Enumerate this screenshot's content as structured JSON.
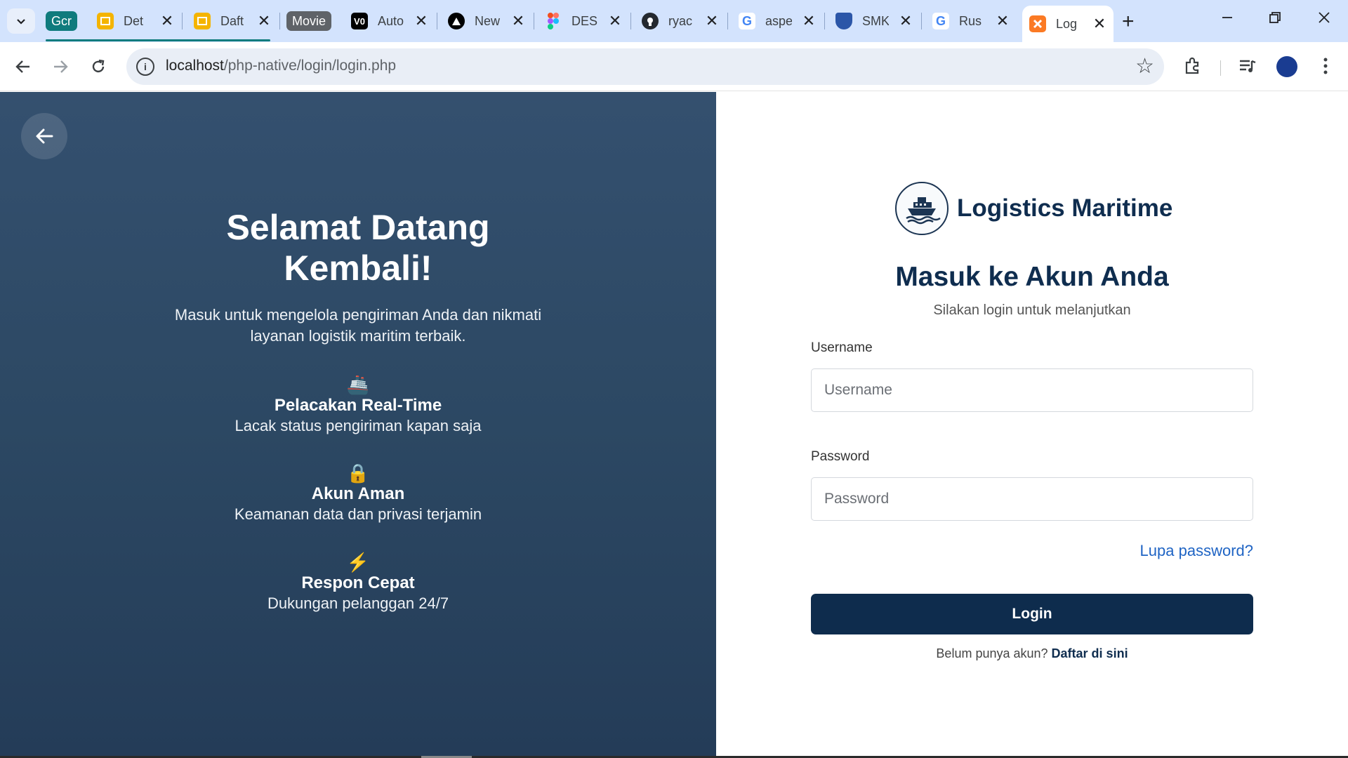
{
  "browser": {
    "tab_group_chips": [
      {
        "label": "Gcr",
        "color": "#0f7b7d"
      },
      {
        "label": "Movie",
        "color": "#5f6368"
      }
    ],
    "tabs": [
      {
        "label": "Det",
        "favicon": "slides-icon",
        "favicon_color": "#f4b400"
      },
      {
        "label": "Daft",
        "favicon": "slides-icon",
        "favicon_color": "#f4b400"
      },
      {
        "label": "Auto",
        "favicon": "vs-code-icon",
        "favicon_color": "#000000"
      },
      {
        "label": "New",
        "favicon": "vercel-icon",
        "favicon_color": "#000000"
      },
      {
        "label": "DES",
        "favicon": "figma-icon",
        "favicon_color": "#f24e1e"
      },
      {
        "label": "ryac",
        "favicon": "github-icon",
        "favicon_color": "#24292f"
      },
      {
        "label": "aspe",
        "favicon": "google-icon",
        "favicon_color": "#4285f4"
      },
      {
        "label": "SMK",
        "favicon": "shield-logo-icon",
        "favicon_color": "#2b56a8"
      },
      {
        "label": "Rus",
        "favicon": "google-icon",
        "favicon_color": "#4285f4"
      },
      {
        "label": "Log",
        "favicon": "xampp-icon",
        "favicon_color": "#fb7a24",
        "active": true
      }
    ],
    "url_host": "localhost",
    "url_path": "/php-native/login/login.php"
  },
  "left": {
    "title": "Selamat Datang Kembali!",
    "subtitle": "Masuk untuk mengelola pengiriman Anda dan nikmati layanan logistik maritim terbaik.",
    "features": [
      {
        "emoji": "🚢",
        "title": "Pelacakan Real-Time",
        "desc": "Lacak status pengiriman kapan saja"
      },
      {
        "emoji": "🔒",
        "title": "Akun Aman",
        "desc": "Keamanan data dan privasi terjamin"
      },
      {
        "emoji": "⚡",
        "title": "Respon Cepat",
        "desc": "Dukungan pelanggan 24/7"
      }
    ]
  },
  "right": {
    "brand": "Logistics Maritime",
    "form_title": "Masuk ke Akun Anda",
    "form_subtitle": "Silakan login untuk melanjutkan",
    "username_label": "Username",
    "username_placeholder": "Username",
    "username_value": "",
    "password_label": "Password",
    "password_placeholder": "Password",
    "password_value": "",
    "forgot_link": "Lupa password?",
    "login_button": "Login",
    "register_prompt": "Belum punya akun?",
    "register_link": "Daftar di sini"
  },
  "colors": {
    "primary": "#0e2c4d",
    "link": "#1f64c4",
    "left_panel": "#2c4863"
  }
}
